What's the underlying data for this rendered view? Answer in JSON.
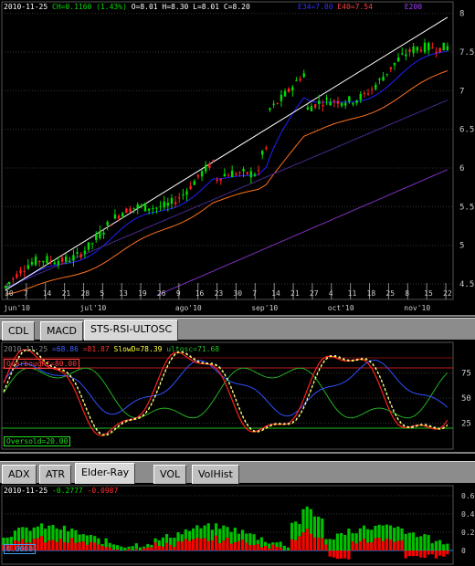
{
  "main_chart": {
    "header": {
      "date": "2010-11-25",
      "change": "CH=0.1160 (1.43%)",
      "ohlc": "O=8.01 H=8.30 L=8.01 C=8.20",
      "ma1": "E34=7.80",
      "ma2": "E40=7.54",
      "ma3": "E200"
    },
    "y_ticks": [
      "8",
      "7.5",
      "7",
      "6.5",
      "6",
      "5.5",
      "5",
      "4.5"
    ],
    "x_ticks": [
      "30",
      "7",
      "14",
      "21",
      "28",
      "5",
      "13",
      "19",
      "26",
      "9",
      "16",
      "23",
      "30",
      "7",
      "14",
      "21",
      "27",
      "4",
      "11",
      "18",
      "25",
      "8",
      "15",
      "22"
    ],
    "months": [
      "jun'10",
      "jul'10",
      "ago'10",
      "sep'10",
      "oct'10",
      "nov'10"
    ],
    "colors": {
      "up": "#00dd00",
      "down": "#ff2020",
      "ma_blue": "#2020ff",
      "ma_orange": "#ff7020",
      "ma_purple": "#8030c0",
      "trendline": "#ffffff"
    }
  },
  "indicator_panel": {
    "tabs": [
      "CDL",
      "MACD",
      "STS-RSI-ULTOSC"
    ],
    "active_tab": "STS-RSI-ULTOSC",
    "header": {
      "date": "2010-11-25",
      "v1": "=68.86",
      "v2": "=81.87",
      "slowd": "SlowD=78.39",
      "ultosc": "ultosc=71.68"
    },
    "overbought_label": "Overbought=80.00",
    "oversold_label": "Oversold=20.00",
    "y_ticks": [
      "75",
      "50",
      "25"
    ]
  },
  "volume_panel": {
    "tabs": [
      "ADX",
      "ATR",
      "Elder-Ray",
      "VOL",
      "VolHist"
    ],
    "active_tab": "Elder-Ray",
    "header": {
      "date": "2010-11-25",
      "bull": "-0.2777",
      "bear": "-0.0987"
    },
    "zero_label": "0.0000",
    "y_ticks": [
      "0.6",
      "0.4",
      "0.2",
      "0"
    ]
  }
}
